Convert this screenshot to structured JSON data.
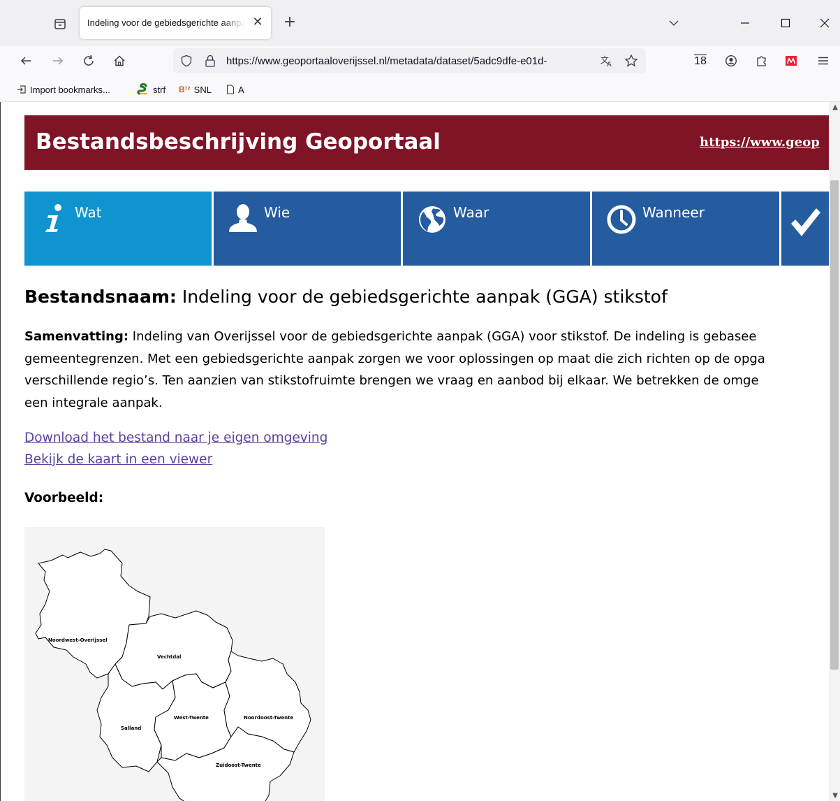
{
  "browser": {
    "tab_title": "Indeling voor de gebiedsgerichte aanpak (GGA) stikstof",
    "tab_close": "✕",
    "new_tab": "+",
    "url": "https://www.geoportaaloverijssel.nl/metadata/dataset/5adc9dfe-e01d-",
    "calendar_badge": "18",
    "bookmarks": [
      {
        "label": "Import bookmarks...",
        "icon": "import-icon"
      },
      {
        "label": "strf",
        "icon": "snake-icon"
      },
      {
        "label": "SNL",
        "icon": "bij12-icon",
        "icon_text": "B¹²"
      },
      {
        "label": "A",
        "icon": "page-icon"
      }
    ]
  },
  "page": {
    "banner": {
      "title": "Bestandsbeschrijving Geoportaal",
      "link": "https://www.geop",
      "color": "#7f1426"
    },
    "nav_tiles": [
      {
        "label": "Wat",
        "icon": "info-icon",
        "active": true
      },
      {
        "label": "Wie",
        "icon": "person-icon",
        "active": false
      },
      {
        "label": "Waar",
        "icon": "globe-icon",
        "active": false
      },
      {
        "label": "Wanneer",
        "icon": "clock-icon",
        "active": false
      },
      {
        "label": "",
        "icon": "checkmark-icon",
        "active": false
      }
    ],
    "nav_colors": {
      "default": "#255b9f",
      "active": "#0f94cf"
    },
    "dataset": {
      "name_label": "Bestandsnaam:",
      "name": "Indeling voor de gebiedsgerichte aanpak (GGA) stikstof"
    },
    "summary": {
      "label": "Samenvatting:",
      "lines": [
        "Indeling van Overijssel voor de gebiedsgerichte aanpak (GGA) voor stikstof. De indeling is gebasee",
        "gemeentegrenzen. Met een gebiedsgerichte aanpak zorgen we voor oplossingen op maat die zich richten op de opga",
        "verschillende regio’s. Ten aanzien van stikstofruimte brengen we vraag en aanbod bij elkaar. We betrekken de omge",
        "een integrale aanpak."
      ]
    },
    "links": {
      "download": "Download het bestand naar je eigen omgeving",
      "viewer": "Bekijk de kaart in een viewer"
    },
    "preview": {
      "label": "Voorbeeld:",
      "regions": [
        "Noordwest-Overijssel",
        "Vechtdal",
        "Salland",
        "West-Twente",
        "Noordoost-Twente",
        "Zuidoost-Twente"
      ]
    }
  }
}
